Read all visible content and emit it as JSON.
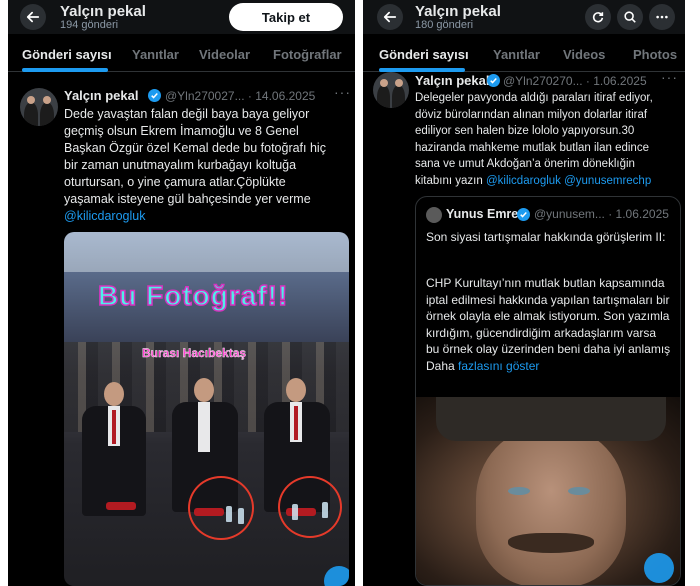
{
  "left": {
    "header": {
      "name": "Yalçın pekal",
      "post_count": "194 gönderi",
      "follow_label": "Takip et"
    },
    "tabs": [
      "Gönderi sayısı",
      "Yanıtlar",
      "Videolar",
      "Fotoğraflar"
    ],
    "post": {
      "author": "Yalçın pekal",
      "handle_date": "@Yln270027... · 14.06.2025",
      "menu": "···",
      "text_lines": [
        "Dede yavaştan falan değil baya baya geliyor",
        "geçmiş olsun Ekrem İmamoğlu ve 8 Genel",
        "Başkan Özgür özel Kemal dede bu fotoğrafı hiç",
        "bir zaman unutmayalım kurbağayı koltuğa",
        "oturtursan, o yine çamura atlar.Çöplükte",
        "yaşamak isteyene gül bahçesinde yer verme"
      ],
      "mention": "@kilicdarogluk",
      "image_title": "Bu Fotoğraf!!",
      "image_subtitle": "Burası Hacıbektaş"
    }
  },
  "right": {
    "header": {
      "name": "Yalçın pekal",
      "post_count": "180 gönderi"
    },
    "tabs": [
      "Gönderi sayısı",
      "Yanıtlar",
      "Videos",
      "Photos"
    ],
    "post": {
      "author": "Yalçın pekal",
      "handle_date": "@Yln270270... · 1.06.2025",
      "menu": "···",
      "text_lines": [
        "Delegeler pavyonda aldığı paraları itiraf ediyor,",
        "döviz bürolarından alınan milyon dolarlar itiraf",
        "ediliyor sen halen bize lololo  yapıyorsun.30",
        "haziranda mahkeme mutlak butlan ilan edince",
        "sana ve umut Akdoğan’a önerim döneklığin"
      ],
      "last_line_prefix": "kitabını yazın ",
      "mentions": "@kilicdarogluk @yunusemrechp",
      "quote": {
        "author": "Yunus Emre",
        "handle_date": "@yunusem... · 1.06.2025",
        "para1": "Son siyasi tartışmalar hakkında görüşlerim II:",
        "para2": "CHP Kurultayı’nın mutlak butlan kapsamında iptal edilmesi hakkında yapılan tartışmaları bir örnek olayla ele almak istiyorum. Son yazımla kırdığım, gücendirdiğim arkadaşlarım varsa bu örnek olay üzerinden beni daha iyi anlamış Daha",
        "more": "fazlasını göster"
      }
    }
  },
  "colors": {
    "accent": "#1d9bf0",
    "bg": "#000000",
    "muted": "#71767b"
  },
  "icons": [
    "back-arrow-icon",
    "verified-badge-icon",
    "refresh-icon",
    "search-icon",
    "more-icon"
  ]
}
